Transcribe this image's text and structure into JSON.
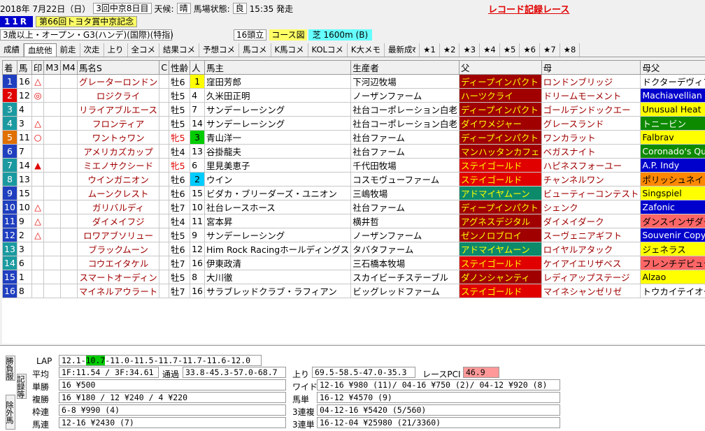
{
  "header": {
    "date": "2018年 7月22日（日）",
    "meeting": "3回中京8日目",
    "weather_label": "天候:",
    "weather": "晴",
    "track_label": "馬場状態:",
    "track": "良",
    "post_time": "15:35 発走",
    "record_note": "レコード記録レース",
    "race_number": "11R",
    "race_name": "第66回トヨタ賞中京記念",
    "conditions": "3歳以上・オープン・G3(ハンデ)(国際)(特指)",
    "field_size": "16頭立",
    "course_label": "コース図",
    "course": "芝 1600m (B)"
  },
  "tabs": [
    "成績",
    "血統他",
    "前走",
    "次走",
    "上り",
    "全コメ",
    "結果コメ",
    "予想コメ",
    "馬コメ",
    "K馬コメ",
    "KOLコメ",
    "K大メモ",
    "最新成र",
    "★1",
    "★2",
    "★3",
    "★4",
    "★5",
    "★6",
    "★7",
    "★8"
  ],
  "active_tab": "血統他",
  "columns": [
    "着",
    "馬",
    "印",
    "M3",
    "M4",
    "馬名S",
    "C",
    "性齢",
    "人",
    "馬主",
    "生産者",
    "父",
    "母",
    "母父"
  ],
  "rows": [
    {
      "finish": "1",
      "num": "16",
      "mark": "△",
      "name": "グレーターロンドン",
      "sex": "牡6",
      "pop": "1",
      "owner": "窪田芳郎",
      "breeder": "下河辺牧場",
      "sire": "ディープインパクト",
      "dam": "ロンドンブリッジ",
      "damsire": "ドクターデヴィアス"
    },
    {
      "finish": "2",
      "num": "12",
      "mark": "◎",
      "name": "ロジクライ",
      "sex": "牡5",
      "pop": "4",
      "owner": "久米田正明",
      "breeder": "ノーザンファーム",
      "sire": "ハーツクライ",
      "dam": "ドリームモーメント",
      "damsire": "Machiavellian"
    },
    {
      "finish": "3",
      "num": "4",
      "mark": "",
      "name": "リライアブルエース",
      "sex": "牡5",
      "pop": "7",
      "owner": "サンデーレーシング",
      "breeder": "社台コーポレーション白老",
      "sire": "ディープインパクト",
      "dam": "ゴールデンドックエー",
      "damsire": "Unusual Heat"
    },
    {
      "finish": "4",
      "num": "3",
      "mark": "△",
      "name": "フロンティア",
      "sex": "牡5",
      "pop": "14",
      "owner": "サンデーレーシング",
      "breeder": "社台コーポレーション白老",
      "sire": "ダイワメジャー",
      "dam": "グレースランド",
      "damsire": "トニービン"
    },
    {
      "finish": "5",
      "num": "11",
      "mark": "○",
      "name": "ワントゥワン",
      "sex": "牝5",
      "pop": "3",
      "owner": "青山洋一",
      "breeder": "社台ファーム",
      "sire": "ディープインパクト",
      "dam": "ワンカラット",
      "damsire": "Falbrav"
    },
    {
      "finish": "6",
      "num": "7",
      "mark": "",
      "name": "アメリカズカップ",
      "sex": "牡4",
      "pop": "13",
      "owner": "谷掛龍夫",
      "breeder": "社台ファーム",
      "sire": "マンハッタンカフェ",
      "dam": "ベガスナイト",
      "damsire": "Coronado's Quest"
    },
    {
      "finish": "7",
      "num": "14",
      "mark": "▲",
      "name": "ミエノサクシード",
      "sex": "牝5",
      "pop": "6",
      "owner": "里見美恵子",
      "breeder": "千代田牧場",
      "sire": "ステイゴールド",
      "dam": "ハピネスフォーユー",
      "damsire": "A.P. Indy"
    },
    {
      "finish": "8",
      "num": "13",
      "mark": "",
      "name": "ウインガニオン",
      "sex": "牡6",
      "pop": "2",
      "owner": "ウイン",
      "breeder": "コスモヴューファーム",
      "sire": "ステイゴールド",
      "dam": "チャンネルワン",
      "damsire": "ポリッシュネイビー"
    },
    {
      "finish": "9",
      "num": "15",
      "mark": "",
      "name": "ムーンクレスト",
      "sex": "牡6",
      "pop": "15",
      "owner": "ビダカ・ブリーダーズ・ユニオン",
      "breeder": "三嶋牧場",
      "sire": "アドマイヤムーン",
      "dam": "ビューティーコンテスト",
      "damsire": "Singspiel"
    },
    {
      "finish": "10",
      "num": "10",
      "mark": "△",
      "name": "ガリバルディ",
      "sex": "牡7",
      "pop": "10",
      "owner": "社台レースホース",
      "breeder": "社台ファーム",
      "sire": "ディープインパクト",
      "dam": "シェンク",
      "damsire": "Zafonic"
    },
    {
      "finish": "11",
      "num": "9",
      "mark": "△",
      "name": "ダイメイフジ",
      "sex": "牡4",
      "pop": "11",
      "owner": "宮本昇",
      "breeder": "横井哲",
      "sire": "アグネスデジタル",
      "dam": "ダイメイダーク",
      "damsire": "ダンスインザダーク"
    },
    {
      "finish": "12",
      "num": "2",
      "mark": "△",
      "name": "ロワアブソリュー",
      "sex": "牡5",
      "pop": "9",
      "owner": "サンデーレーシング",
      "breeder": "ノーザンファーム",
      "sire": "ゼンノロブロイ",
      "dam": "スーヴェニアギフト",
      "damsire": "Souvenir Copy"
    },
    {
      "finish": "13",
      "num": "3",
      "mark": "",
      "name": "ブラックムーン",
      "sex": "牡6",
      "pop": "12",
      "owner": "Him Rock Racingホールディングス",
      "breeder": "タバタファーム",
      "sire": "アドマイヤムーン",
      "dam": "ロイヤルアタック",
      "damsire": "ジェネラス"
    },
    {
      "finish": "14",
      "num": "6",
      "mark": "",
      "name": "コウエイタケル",
      "sex": "牡7",
      "pop": "16",
      "owner": "伊東政清",
      "breeder": "三石橋本牧場",
      "sire": "ステイゴールド",
      "dam": "ケイアイエリザベス",
      "damsire": "フレンチデピュティ"
    },
    {
      "finish": "15",
      "num": "1",
      "mark": "",
      "name": "スマートオーディン",
      "sex": "牡5",
      "pop": "8",
      "owner": "大川徹",
      "breeder": "スカイビーチステーブル",
      "sire": "ダノンシャンティ",
      "dam": "レディアップステージ",
      "damsire": "Alzao"
    },
    {
      "finish": "16",
      "num": "8",
      "mark": "",
      "name": "マイネルアウラート",
      "sex": "牡7",
      "pop": "16",
      "owner": "サラブレッドクラブ・ラフィアン",
      "breeder": "ビッグレッドファーム",
      "sire": "ステイゴールド",
      "dam": "マイネシャンゼリゼ",
      "damsire": "トウカイテイオー"
    }
  ],
  "finish_colors": [
    "#1f3fbf",
    "#e00000",
    "#1a9aa0",
    "#1a9aa0",
    "#e07000",
    "#1f3fbf",
    "#1a9aa0",
    "#1a9aa0",
    "#1f3fbf",
    "#1f3fbf",
    "#1f3fbf",
    "#1f3fbf",
    "#1a9aa0",
    "#1a9aa0",
    "#1f3fbf",
    "#1f3fbf"
  ],
  "cell_colors": {
    "sire": [
      "#a00000",
      "#a00000",
      "#a00000",
      "#a00000",
      "#a00000",
      "#a00000",
      "#e00000",
      "#e00000",
      "#0d8a6a",
      "#a00000",
      "#a00000",
      "#a00000",
      "#0d8a6a",
      "#e00000",
      "#a00000",
      "#e00000"
    ],
    "damsire": [
      "#ffffff",
      "#0000cc",
      "#ffff00",
      "#0d8a00",
      "#ffff00",
      "#0d8a00",
      "#0000cc",
      "#ff8800",
      "#ffff00",
      "#0000cc",
      "#ff6666",
      "#0000cc",
      "#ffff00",
      "#ff6666",
      "#ffff00",
      "#ffffff"
    ]
  },
  "bottom": {
    "vtabs": [
      "勝負服",
      "記録等",
      "除外馬"
    ],
    "lap_label": "LAP",
    "lap_before": "12.1-",
    "lap_hl": "10.7",
    "lap_after": "-11.0-11.5-11.7-11.7-11.6-12.0",
    "avg_label": "平均",
    "avg": "1F:11.54 / 3F:34.61",
    "passing_label": "通過",
    "passing": "33.8-45.3-57.0-68.7",
    "agari_label": "上り",
    "agari": "69.5-58.5-47.0-35.3",
    "pci_label": "レースPCI",
    "pci": "46.9",
    "tansho_label": "単勝",
    "tansho": "16 ¥500",
    "fukusho_label": "複勝",
    "fukusho": "16 ¥180 / 12 ¥240 / 4 ¥220",
    "wakuren_label": "枠連",
    "wakuren": "6-8 ¥990 (4)",
    "umaren_label": "馬連",
    "umaren": "12-16 ¥2430 (7)",
    "wide_label": "ワイド",
    "wide": "12-16 ¥980 (11)/ 04-16 ¥750 (2)/ 04-12 ¥920 (8)",
    "umatan_label": "馬単",
    "umatan": "16-12 ¥4570 (9)",
    "sanrenpuku_label": "3連複",
    "sanrenpuku": "04-12-16 ¥5420 (5/560)",
    "sanrentan_label": "3連単",
    "sanrentan": "16-12-04 ¥25980 (21/3360)"
  }
}
